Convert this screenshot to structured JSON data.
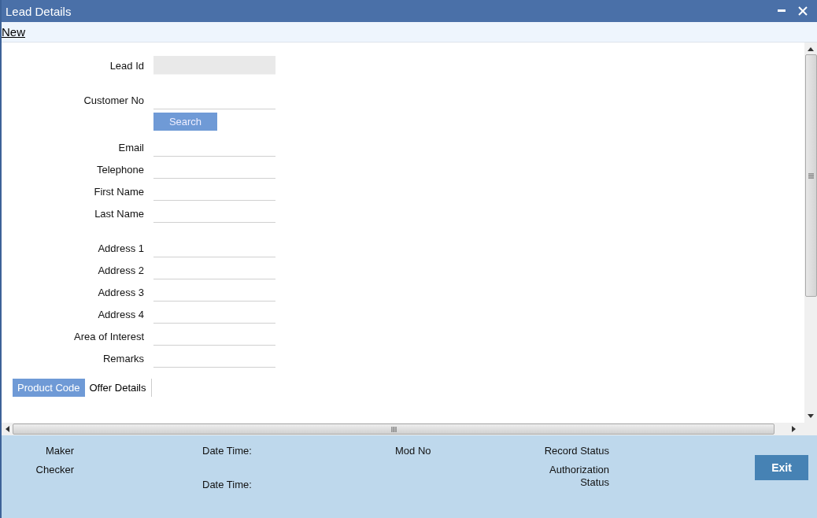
{
  "window": {
    "title": "Lead Details"
  },
  "toolbar": {
    "link": "New"
  },
  "form": {
    "groups": [
      [
        {
          "kind": "field",
          "label": "Lead Id",
          "disabled": true
        },
        {
          "kind": "field",
          "label": "Customer No",
          "disabled": false
        },
        {
          "kind": "button",
          "label": "Search"
        }
      ],
      [
        {
          "kind": "field",
          "label": "Email",
          "disabled": false
        },
        {
          "kind": "field",
          "label": "Telephone",
          "disabled": false
        },
        {
          "kind": "field",
          "label": "First Name",
          "disabled": false
        },
        {
          "kind": "field",
          "label": "Last Name",
          "disabled": false
        }
      ],
      [
        {
          "kind": "field",
          "label": "Address 1",
          "disabled": false
        },
        {
          "kind": "field",
          "label": "Address 2",
          "disabled": false
        },
        {
          "kind": "field",
          "label": "Address 3",
          "disabled": false
        },
        {
          "kind": "field",
          "label": "Address 4",
          "disabled": false
        },
        {
          "kind": "field",
          "label": "Area of Interest",
          "disabled": false
        },
        {
          "kind": "field",
          "label": "Remarks",
          "disabled": false
        }
      ]
    ]
  },
  "tabs": [
    {
      "label": "Product Code",
      "selected": true
    },
    {
      "label": "Offer Details",
      "selected": false
    }
  ],
  "footer": {
    "maker": "Maker",
    "checker": "Checker",
    "maker_date_time": "Date Time:",
    "checker_date_time": "Date Time:",
    "mod_no": "Mod No",
    "record_status": "Record Status",
    "authorization_status": "Authorization Status",
    "exit_button": "Exit"
  }
}
